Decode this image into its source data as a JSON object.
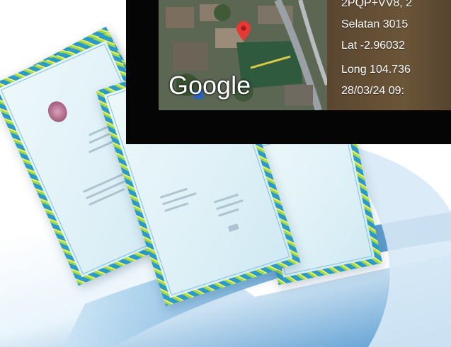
{
  "map": {
    "brand": "Google"
  },
  "geotag": {
    "lines": [
      "2PQP+VV8, 2",
      "Selatan 3015",
      "Lat -2.96032",
      "Long 104.736",
      "28/03/24 09:"
    ]
  },
  "colors": {
    "overlay_bg": "#050505",
    "pin": "#e53935",
    "cert_border_blue": "#2a9bc9",
    "cert_border_green": "#9fd84a"
  }
}
